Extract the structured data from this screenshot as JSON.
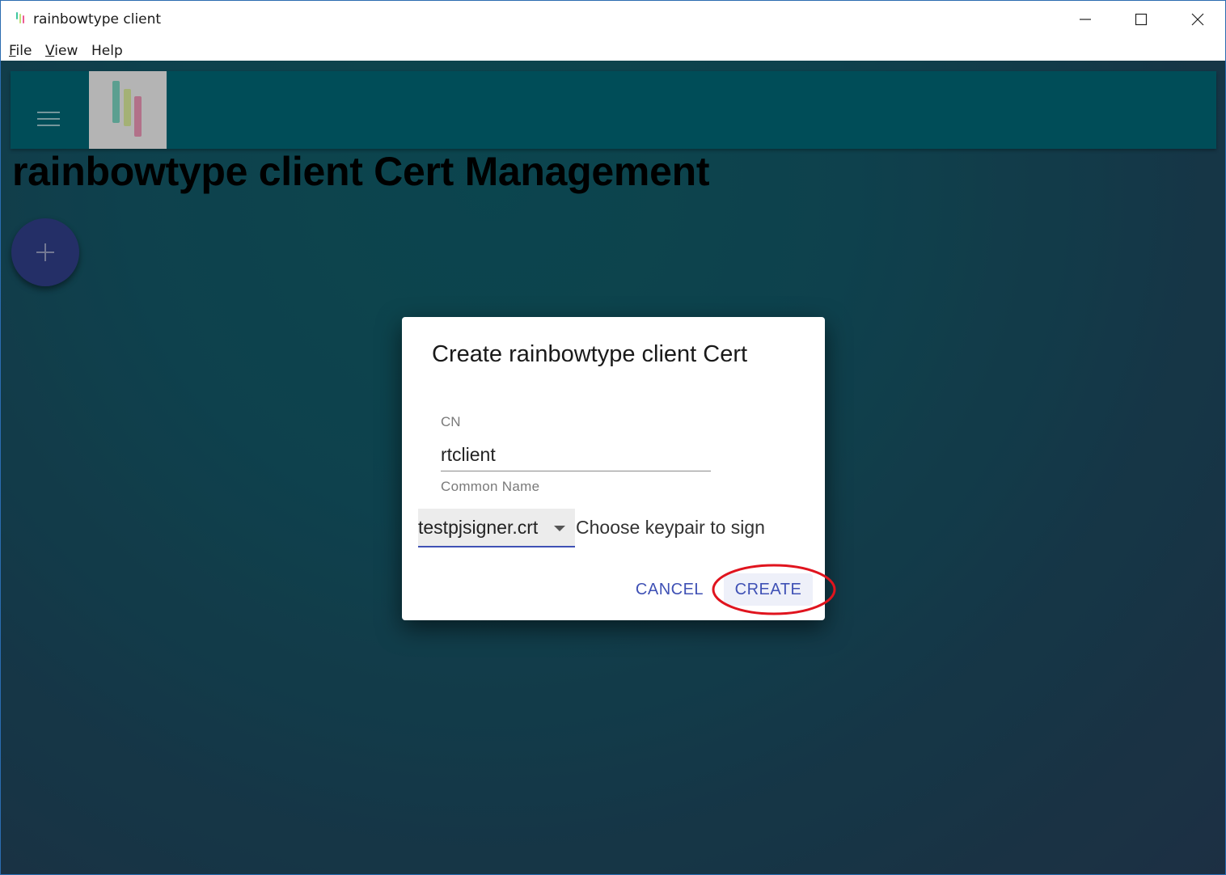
{
  "window": {
    "title": "rainbowtype client",
    "controls": {
      "minimize": "minimize",
      "maximize": "maximize",
      "close": "close"
    }
  },
  "menubar": {
    "items": [
      {
        "key": "F",
        "rest": "ile"
      },
      {
        "key": "V",
        "rest": "iew"
      },
      {
        "key": "",
        "rest": "Help"
      }
    ]
  },
  "page": {
    "title": "rainbowtype client Cert Management"
  },
  "dialog": {
    "title": "Create rainbowtype client Cert",
    "cn_label": "CN",
    "cn_value": "rtclient",
    "cn_helper": "Common Name",
    "keypair_value": "testpjsigner.crt",
    "keypair_label": "Choose keypair to sign",
    "cancel_label": "CANCEL",
    "create_label": "CREATE"
  },
  "colors": {
    "appbar": "#005f6c",
    "fab": "#2d3a7e",
    "accent": "#3f51b5",
    "annotation": "#e0141e"
  },
  "icons": {
    "menu": "hamburger-icon",
    "fab": "plus-icon",
    "select": "arrow-drop-down-icon"
  }
}
